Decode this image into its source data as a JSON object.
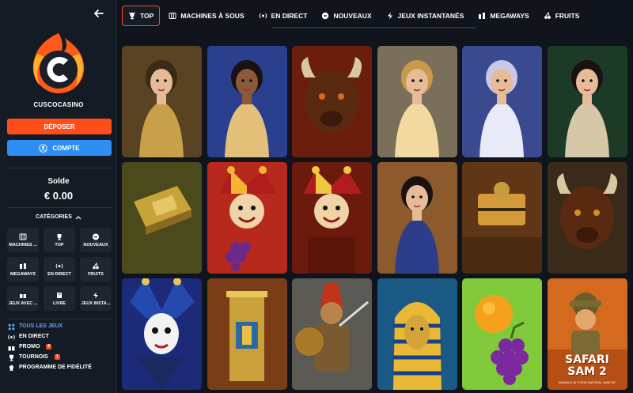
{
  "brand": {
    "name": "CUSCOCASINO"
  },
  "buttons": {
    "deposit": "DÉPOSER",
    "account": "COMPTE"
  },
  "balance": {
    "label": "Solde",
    "value": "€ 0.00"
  },
  "categories": {
    "title": "CATÉGORIES",
    "items": [
      {
        "label": "MACHINES ...",
        "icon": "slot-machine-icon"
      },
      {
        "label": "TOP",
        "icon": "trophy-icon"
      },
      {
        "label": "NOUVEAUX",
        "icon": "new-badge-icon"
      },
      {
        "label": "MEGAWAYS",
        "icon": "megaways-icon"
      },
      {
        "label": "EN DIRECT",
        "icon": "live-icon"
      },
      {
        "label": "FRUITS",
        "icon": "cherry-icon"
      },
      {
        "label": "JEUX AVEC ...",
        "icon": "bonus-icon"
      },
      {
        "label": "LIVRE",
        "icon": "book-icon"
      },
      {
        "label": "JEUX INSTA...",
        "icon": "instant-icon"
      }
    ]
  },
  "nav": {
    "items": [
      {
        "label": "TOUS LES JEUX",
        "icon": "all-games-icon",
        "active": true
      },
      {
        "label": "EN DIRECT",
        "icon": "live-icon"
      },
      {
        "label": "PROMO",
        "icon": "gift-icon",
        "badge": "6"
      },
      {
        "label": "TOURNOIS",
        "icon": "trophy-icon",
        "badge": "1"
      },
      {
        "label": "PROGRAMME DE FIDÉLITÉ",
        "icon": "medal-icon"
      }
    ]
  },
  "tabs": [
    {
      "label": "TOP",
      "icon": "trophy-icon",
      "active": true
    },
    {
      "label": "MACHINES À SOUS",
      "icon": "slot-machine-icon"
    },
    {
      "label": "EN DIRECT",
      "icon": "live-icon"
    },
    {
      "label": "NOUVEAUX",
      "icon": "new-badge-icon"
    },
    {
      "label": "JEUX INSTANTANÉS",
      "icon": "instant-icon"
    },
    {
      "label": "MEGAWAYS",
      "icon": "megaways-icon"
    },
    {
      "label": "FRUITS",
      "icon": "cherry-icon"
    }
  ],
  "games": [
    {
      "bg": "#5a4322",
      "accent": "#c9a04a",
      "kind": "explorer"
    },
    {
      "bg": "#2b3f8f",
      "accent": "#e3c07a",
      "kind": "queen"
    },
    {
      "bg": "#6b1d0e",
      "accent": "#d96a22",
      "kind": "bull"
    },
    {
      "bg": "#7a6f5a",
      "accent": "#f2d9a0",
      "kind": "goddess"
    },
    {
      "bg": "#3b4a8f",
      "accent": "#e8eaf8",
      "kind": "ice-queen"
    },
    {
      "bg": "#1d3a26",
      "accent": "#d6c7a8",
      "kind": "princess"
    },
    {
      "bg": "#4b4a1c",
      "accent": "#c8a33a",
      "kind": "book"
    },
    {
      "bg": "#b7291c",
      "accent": "#f3b532",
      "kind": "jester"
    },
    {
      "bg": "#6c1a0d",
      "accent": "#f1c640",
      "kind": "joker"
    },
    {
      "bg": "#8c5a2c",
      "accent": "#2c3e8a",
      "kind": "snow-white"
    },
    {
      "bg": "#5f3616",
      "accent": "#d49a3a",
      "kind": "chest"
    },
    {
      "bg": "#3a2a1a",
      "accent": "#d98a2a",
      "kind": "bison"
    },
    {
      "bg": "#1d2a7a",
      "accent": "#f2f2f2",
      "kind": "harlequin"
    },
    {
      "bg": "#7a3d18",
      "accent": "#e8c04a",
      "kind": "pillar"
    },
    {
      "bg": "#5c5a55",
      "accent": "#c0341c",
      "kind": "spartan"
    },
    {
      "bg": "#1c5a86",
      "accent": "#e9b936",
      "kind": "pharaoh"
    },
    {
      "bg": "#7fc93a",
      "accent": "#7a2a9e",
      "kind": "fruits"
    },
    {
      "bg": "#d46a1e",
      "accent": "#f3e1b0",
      "kind": "safari"
    }
  ],
  "safari_title": "SAFARI SAM 2",
  "safari_sub": "ANIMALS IN THEIR NATURAL HABITAT",
  "colors": {
    "deposit": "#ff4d1c",
    "account": "#2f8ef4",
    "active_nav": "#5aa7ff",
    "tab_border": "#ff4d1c"
  }
}
